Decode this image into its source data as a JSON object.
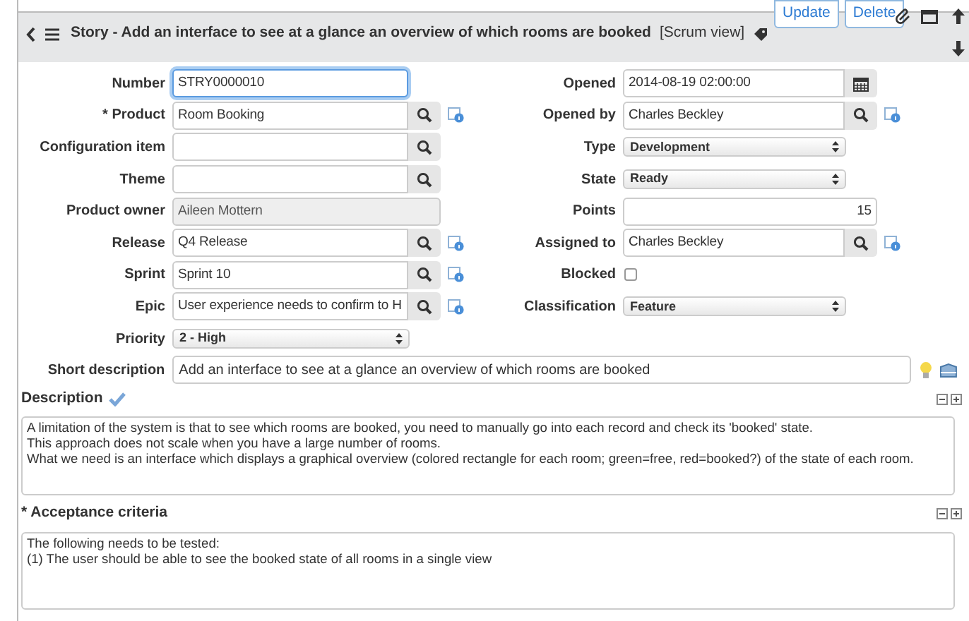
{
  "header": {
    "title": "Story - Add an interface to see at a glance an overview of which rooms are booked",
    "view": "[Scrum view]",
    "buttons": [
      "Update",
      "Delete"
    ]
  },
  "left_fields": [
    {
      "label": "Number",
      "kind": "text",
      "value": "STRY0000010",
      "focused": true
    },
    {
      "label": "* Product",
      "kind": "lookup_info",
      "value": "Room Booking",
      "focused": false
    },
    {
      "label": "Configuration item",
      "kind": "lookup",
      "focused": false
    },
    {
      "label": "Theme",
      "kind": "lookup",
      "focused": false
    },
    {
      "label": "Product owner",
      "kind": "readonly",
      "value": "Aileen Mottern",
      "focused": false
    },
    {
      "label": "Release",
      "kind": "lookup_info",
      "value": "Q4 Release",
      "focused": false
    },
    {
      "label": "Sprint",
      "kind": "lookup_info",
      "value": "Sprint 10",
      "focused": false
    },
    {
      "label": "Epic",
      "kind": "lookup_info",
      "value": "User experience needs to confirm to H",
      "focused": false
    },
    {
      "label": "Priority",
      "kind": "select",
      "value": "2 - High",
      "focused": false
    }
  ],
  "right_fields": [
    {
      "label": "Opened",
      "kind": "date",
      "value": "2014-08-19 02:00:00",
      "focused": false
    },
    {
      "label": "Opened by",
      "kind": "lookup_info",
      "value": "Charles Beckley",
      "focused": false
    },
    {
      "label": "Type",
      "kind": "select",
      "value": "Development",
      "focused": false
    },
    {
      "label": "State",
      "kind": "select",
      "value": "Ready",
      "focused": false
    },
    {
      "label": "Points",
      "kind": "number",
      "value": "15",
      "focused": false
    },
    {
      "label": "Assigned to",
      "kind": "lookup_info",
      "value": "Charles Beckley",
      "focused": false
    },
    {
      "label": "Blocked",
      "kind": "checkbox",
      "checked": false,
      "focused": false
    },
    {
      "label": "Classification",
      "kind": "select",
      "value": "Feature",
      "focused": false
    }
  ],
  "short_description": {
    "label": "Short description",
    "value": "Add an interface to see at a glance an overview of which rooms are booked"
  },
  "description": {
    "label": "Description",
    "lines": [
      "A limitation of the system is that to see which rooms are booked, you need to manually go into each record and check its 'booked' state.",
      "This approach does not scale when you have a large number of rooms.",
      "What we need is an interface which displays a graphical overview (colored rectangle for each room; green=free, red=booked?) of the state of each room."
    ]
  },
  "acceptance_criteria": {
    "label": "* Acceptance criteria",
    "lines": [
      "The following needs to be tested:",
      "(1) The user should be able to see the booked state of all rooms in a single view"
    ]
  }
}
